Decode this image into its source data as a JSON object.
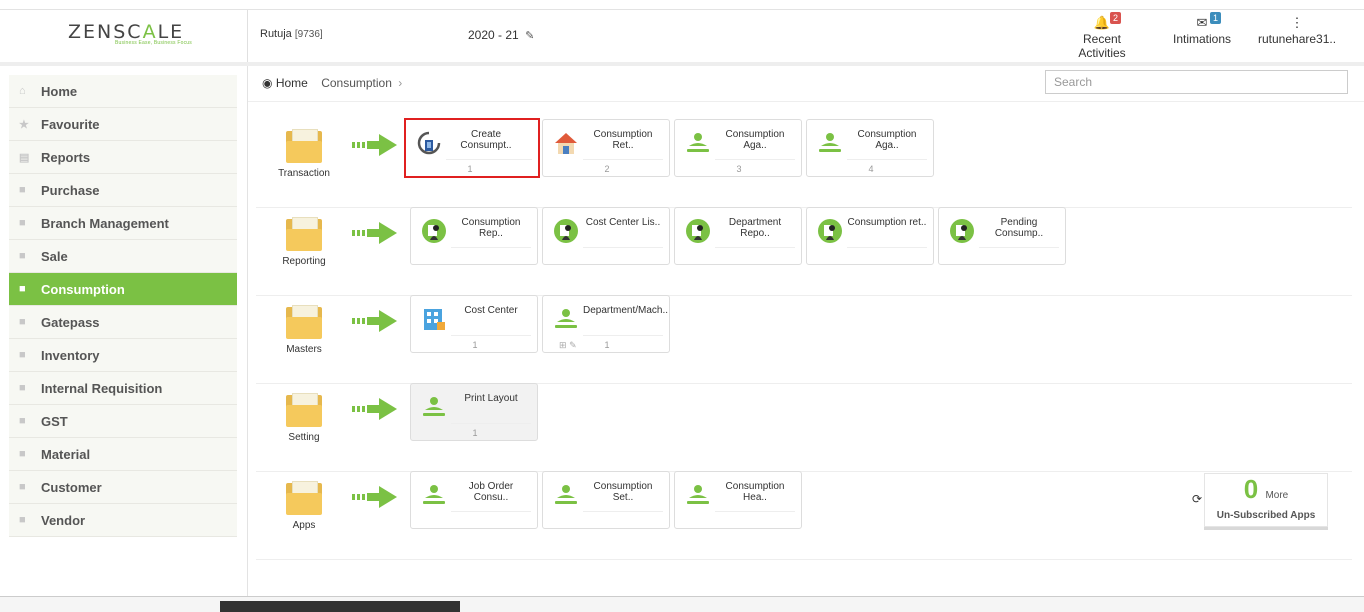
{
  "header": {
    "logo": "ZENSCALE",
    "tagline": "Business Ease, Business Focus",
    "user_name": "Rutuja",
    "user_id": "[9736]",
    "year": "2020 - 21",
    "recent_activities": {
      "label": "Recent Activities",
      "count": "2"
    },
    "intimations": {
      "label": "Intimations",
      "count": "1"
    },
    "account": {
      "label": "rutunehare31.."
    }
  },
  "sidebar": {
    "items": [
      {
        "label": "Home",
        "icon": "home-icon"
      },
      {
        "label": "Favourite",
        "icon": "star-icon"
      },
      {
        "label": "Reports",
        "icon": "document-icon"
      },
      {
        "label": "Purchase",
        "icon": "folder-icon"
      },
      {
        "label": "Branch Management",
        "icon": "folder-icon"
      },
      {
        "label": "Sale",
        "icon": "folder-icon"
      },
      {
        "label": "Consumption",
        "icon": "folder-icon",
        "active": true
      },
      {
        "label": "Gatepass",
        "icon": "folder-icon"
      },
      {
        "label": "Inventory",
        "icon": "folder-icon"
      },
      {
        "label": "Internal Requisition",
        "icon": "folder-icon"
      },
      {
        "label": "GST",
        "icon": "folder-icon"
      },
      {
        "label": "Material",
        "icon": "folder-icon"
      },
      {
        "label": "Customer",
        "icon": "folder-icon"
      },
      {
        "label": "Vendor",
        "icon": "folder-icon"
      }
    ]
  },
  "breadcrumb": {
    "home": "Home",
    "current": "Consumption"
  },
  "search": {
    "placeholder": "Search",
    "value": ""
  },
  "rows": [
    {
      "category": "Transaction",
      "tiles": [
        {
          "name": "Create Consumpt..",
          "num": "1",
          "icon": "refresh-doc-icon"
        },
        {
          "name": "Consumption Ret..",
          "num": "2",
          "icon": "house-icon"
        },
        {
          "name": "Consumption Aga..",
          "num": "3",
          "icon": "user-icon"
        },
        {
          "name": "Consumption Aga..",
          "num": "4",
          "icon": "user-icon"
        }
      ]
    },
    {
      "category": "Reporting",
      "tiles": [
        {
          "name": "Consumption Rep..",
          "num": "",
          "icon": "report-user-icon"
        },
        {
          "name": "Cost Center Lis..",
          "num": "",
          "icon": "report-user-icon"
        },
        {
          "name": "Department Repo..",
          "num": "",
          "icon": "report-user-icon"
        },
        {
          "name": "Consumption ret..",
          "num": "",
          "icon": "report-user-icon"
        },
        {
          "name": "Pending Consump..",
          "num": "",
          "icon": "report-user-icon"
        }
      ]
    },
    {
      "category": "Masters",
      "tiles": [
        {
          "name": "Cost Center",
          "num": "1",
          "icon": "building-icon"
        },
        {
          "name": "Department/Mach..",
          "num": "1",
          "icon": "user-icon"
        }
      ]
    },
    {
      "category": "Setting",
      "tiles": [
        {
          "name": "Print Layout",
          "num": "1",
          "icon": "user-icon"
        }
      ]
    },
    {
      "category": "Apps",
      "tiles": [
        {
          "name": "Job Order Consu..",
          "num": "",
          "icon": "user-icon"
        },
        {
          "name": "Consumption Set..",
          "num": "",
          "icon": "user-icon"
        },
        {
          "name": "Consumption Hea..",
          "num": "",
          "icon": "user-icon"
        }
      ]
    }
  ],
  "unsubscribed": {
    "count": "0",
    "more": "More",
    "label": "Un-Subscribed Apps"
  },
  "colors": {
    "accent": "#7bc144",
    "selection": "#e02020",
    "badge_red": "#d9534f",
    "badge_blue": "#3c8dbc"
  }
}
